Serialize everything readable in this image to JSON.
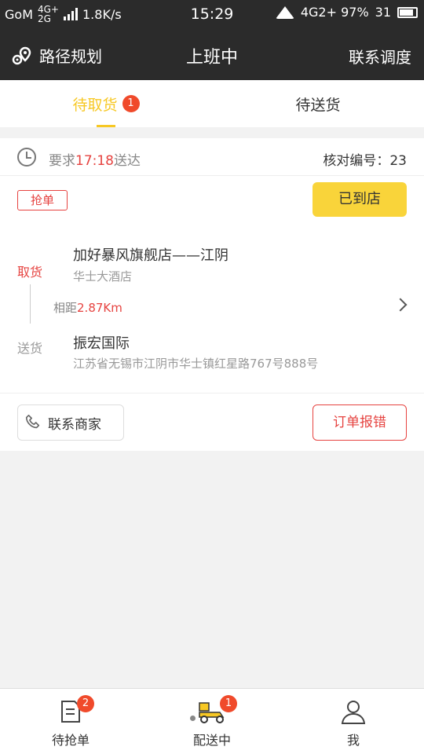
{
  "status_bar": {
    "carrier": "GoM",
    "net1": "4G+",
    "net2": "2G",
    "speed": "1.8K/s",
    "time": "15:29",
    "right_text": "4G2+ 97%",
    "battery": "31"
  },
  "header": {
    "route_label": "路径规划",
    "title": "上班中",
    "contact_label": "联系调度"
  },
  "tabs": [
    {
      "label": "待取货",
      "badge": "1",
      "active": true
    },
    {
      "label": "待送货",
      "active": false
    }
  ],
  "order": {
    "require_prefix": "要求",
    "require_time": "17:18",
    "require_suffix": "送达",
    "verify_label": "核对编号：",
    "verify_number": "23",
    "grab_tag": "抢单",
    "arrived_button": "已到店",
    "pickup_label": "取货",
    "pickup_name": "加好暴风旗舰店——江阴",
    "pickup_address": "华士大酒店",
    "distance_label": "相距",
    "distance_value": "2.87Km",
    "deliver_label": "送货",
    "deliver_name": "振宏国际",
    "deliver_address": "江苏省无锡市江阴市华士镇红星路767号888号",
    "contact_merchant": "联系商家",
    "report_error": "订单报错"
  },
  "bottom_nav": [
    {
      "label": "待抢单",
      "badge": "2",
      "icon": "grab-order-icon"
    },
    {
      "label": "配送中",
      "badge": "1",
      "icon": "scooter-icon"
    },
    {
      "label": "我",
      "icon": "person-icon"
    }
  ],
  "colors": {
    "accent_yellow": "#f7c824",
    "button_yellow": "#f9d43a",
    "alert_red": "#e64340",
    "badge_red": "#f04a2b",
    "dark_bar": "#2b2b2b"
  }
}
